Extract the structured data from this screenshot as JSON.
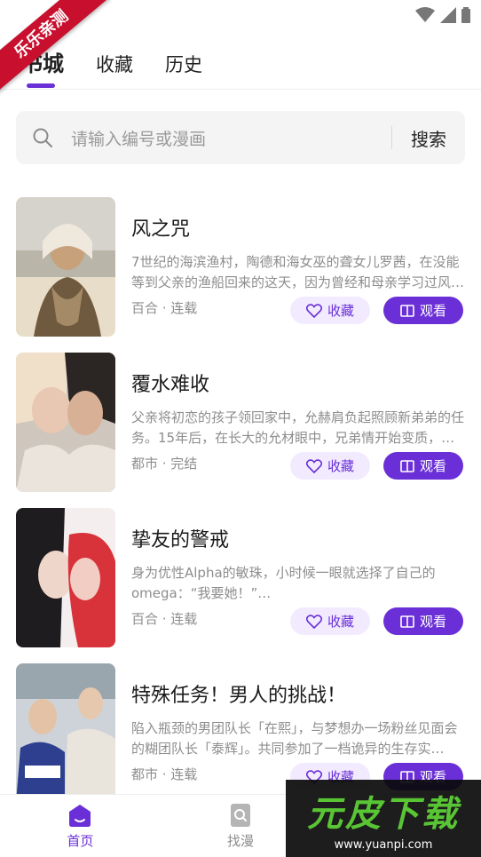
{
  "watermark": {
    "corner_label": "乐乐亲测",
    "brand_main": "元皮下载",
    "brand_url": "www.yuanpi.com"
  },
  "tabs": [
    {
      "label": "书城",
      "active": true
    },
    {
      "label": "收藏",
      "active": false
    },
    {
      "label": "历史",
      "active": false
    }
  ],
  "search": {
    "placeholder": "请输入编号或漫画",
    "button_label": "搜索"
  },
  "comics": [
    {
      "title": "风之咒",
      "description": "7世纪的海滨渔村，陶德和海女巫的聋女儿罗茜，在没能等到父亲的渔船回来的这天，因为曾经和母亲学习过风…",
      "meta": "百合 · 连载",
      "fav_label": "收藏",
      "read_label": "观看"
    },
    {
      "title": "覆水难收",
      "description": "父亲将初恋的孩子领回家中，允赫肩负起照顾新弟弟的任务。15年后，在长大的允材眼中，兄弟情开始变质，…",
      "meta": "都市 · 完结",
      "fav_label": "收藏",
      "read_label": "观看"
    },
    {
      "title": "挚友的警戒",
      "description": "身为优性Alpha的敏珠，小时候一眼就选择了自己的omega：“我要她！”…",
      "meta": "百合 · 连载",
      "fav_label": "收藏",
      "read_label": "观看"
    },
    {
      "title": "特殊任务！男人的挑战！",
      "description": "陷入瓶颈的男团队长「在熙」，与梦想办一场粉丝见面会的糊团队长「泰辉」。共同参加了一档诡异的生存实…",
      "meta": "都市 · 连载",
      "fav_label": "收藏",
      "read_label": "观看"
    }
  ],
  "bottom_nav": [
    {
      "label": "首页",
      "icon": "home-icon",
      "active": true
    },
    {
      "label": "找漫",
      "icon": "find-comic-icon",
      "active": false
    }
  ],
  "colors": {
    "accent": "#6a2fd6",
    "accent_light": "#f2ebff",
    "ribbon": "#c8102e"
  }
}
